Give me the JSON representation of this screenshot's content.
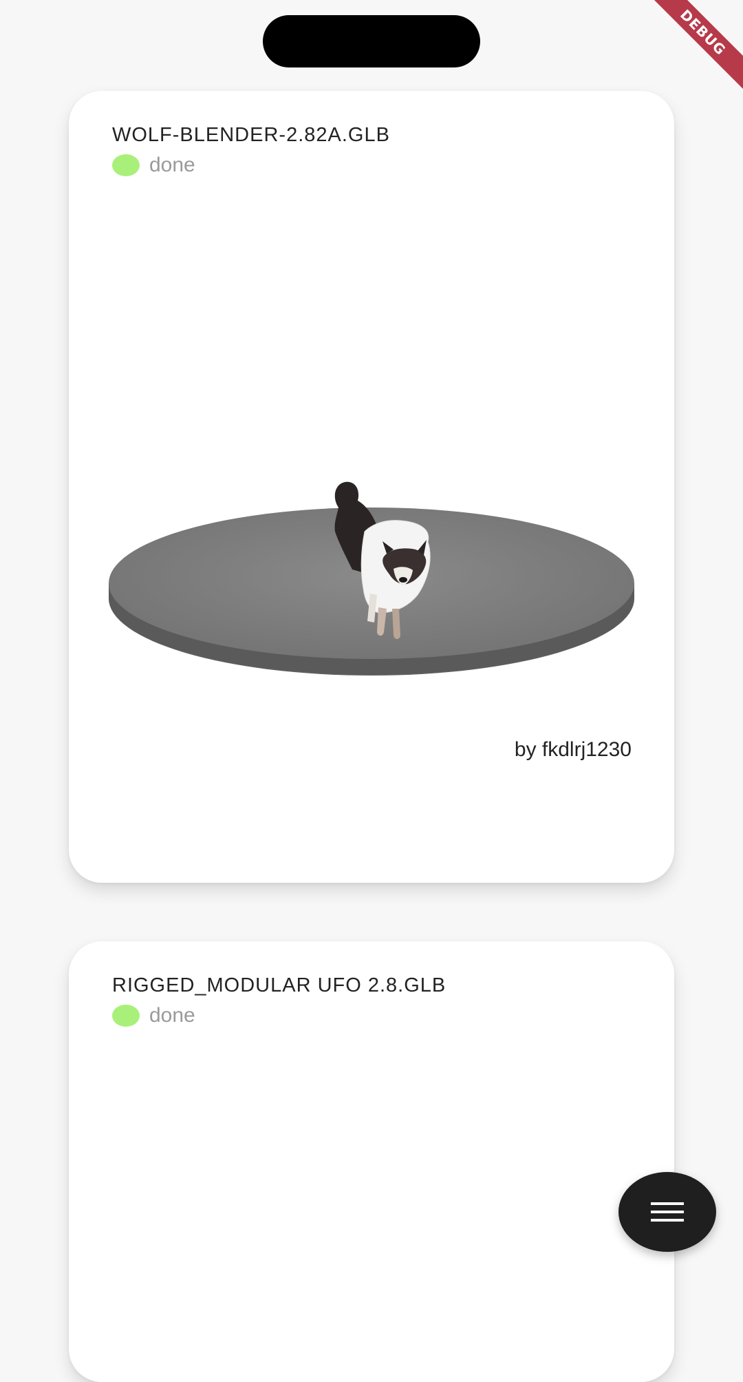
{
  "debug_banner": "DEBUG",
  "cards": [
    {
      "title": "WOLF-BLENDER-2.82A.GLB",
      "status": "done",
      "author": "by fkdlrj1230"
    },
    {
      "title": "RIGGED_MODULAR UFO 2.8.GLB",
      "status": "done"
    }
  ],
  "fab": {
    "icon": "menu-icon"
  },
  "colors": {
    "status_done": "#a9f07a",
    "debug": "#b73a4a",
    "fab_bg": "#1f1f1f"
  }
}
